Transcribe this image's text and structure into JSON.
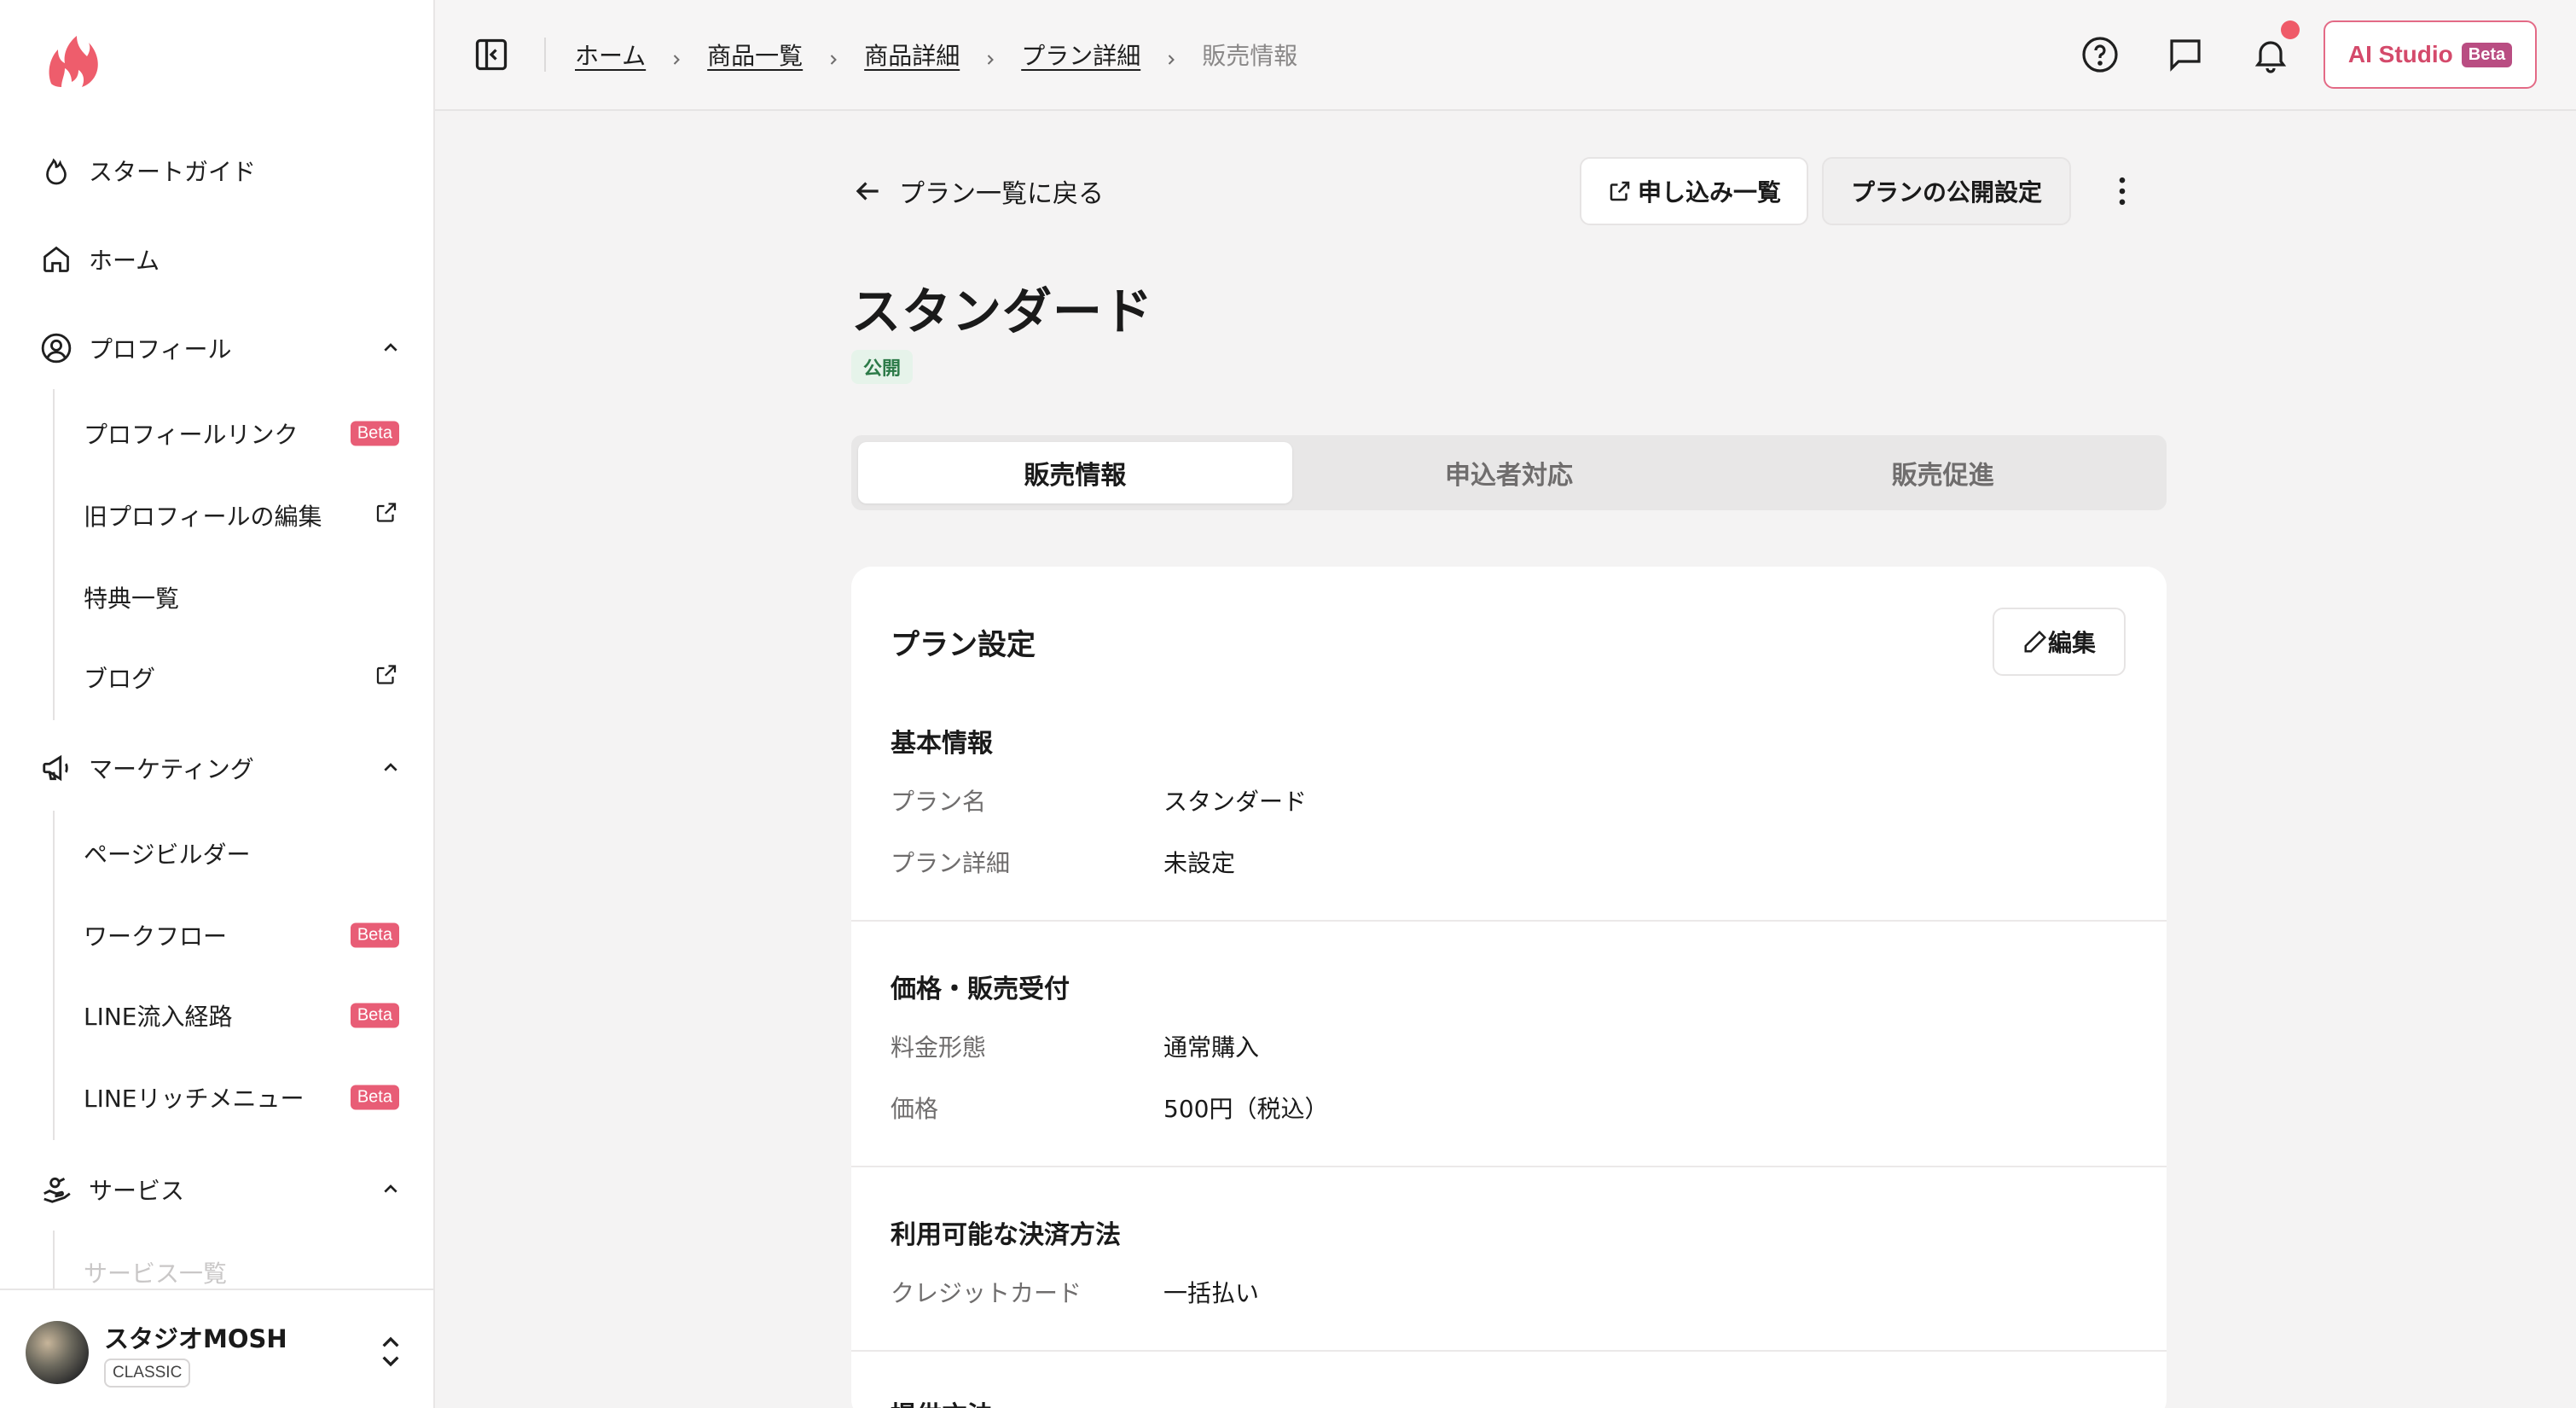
{
  "sidebar": {
    "items": [
      {
        "label": "スタートガイド"
      },
      {
        "label": "ホーム"
      },
      {
        "label": "プロフィール"
      },
      {
        "label": "マーケティング"
      },
      {
        "label": "サービス"
      }
    ],
    "profile_sub": [
      {
        "label": "プロフィールリンク",
        "badge": "Beta"
      },
      {
        "label": "旧プロフィールの編集"
      },
      {
        "label": "特典一覧"
      },
      {
        "label": "ブログ"
      }
    ],
    "marketing_sub": [
      {
        "label": "ページビルダー"
      },
      {
        "label": "ワークフロー",
        "badge": "Beta"
      },
      {
        "label": "LINE流入経路",
        "badge": "Beta"
      },
      {
        "label": "LINEリッチメニュー",
        "badge": "Beta"
      }
    ],
    "service_sub": [
      {
        "label": "サービス一覧"
      }
    ],
    "account": {
      "name": "スタジオMOSH",
      "plan": "CLASSIC"
    }
  },
  "breadcrumb": [
    "ホーム",
    "商品一覧",
    "商品詳細",
    "プラン詳細",
    "販売情報"
  ],
  "topbar": {
    "ai_label": "AI Studio",
    "ai_badge": "Beta"
  },
  "main": {
    "back_label": "プラン一覧に戻る",
    "applications_button": "申し込み一覧",
    "publish_button": "プランの公開設定",
    "plan_name": "スタンダード",
    "status": "公開",
    "tabs": [
      "販売情報",
      "申込者対応",
      "販売促進"
    ],
    "card": {
      "title": "プラン設定",
      "edit_label": "編集",
      "sections": {
        "basic": {
          "title": "基本情報",
          "rows": [
            {
              "label": "プラン名",
              "value": "スタンダード"
            },
            {
              "label": "プラン詳細",
              "value": "未設定"
            }
          ]
        },
        "price": {
          "title": "価格・販売受付",
          "rows": [
            {
              "label": "料金形態",
              "value": "通常購入"
            },
            {
              "label": "価格",
              "value": "500円（税込）"
            }
          ]
        },
        "payment": {
          "title": "利用可能な決済方法",
          "rows": [
            {
              "label": "クレジットカード",
              "value": "一括払い"
            }
          ]
        },
        "next": {
          "title": "提供方法"
        }
      }
    }
  },
  "colors": {
    "accent": "#e85d76",
    "ai_border": "#e36a86",
    "published_bg": "#e6f3ea",
    "published_text": "#2c7a48"
  }
}
